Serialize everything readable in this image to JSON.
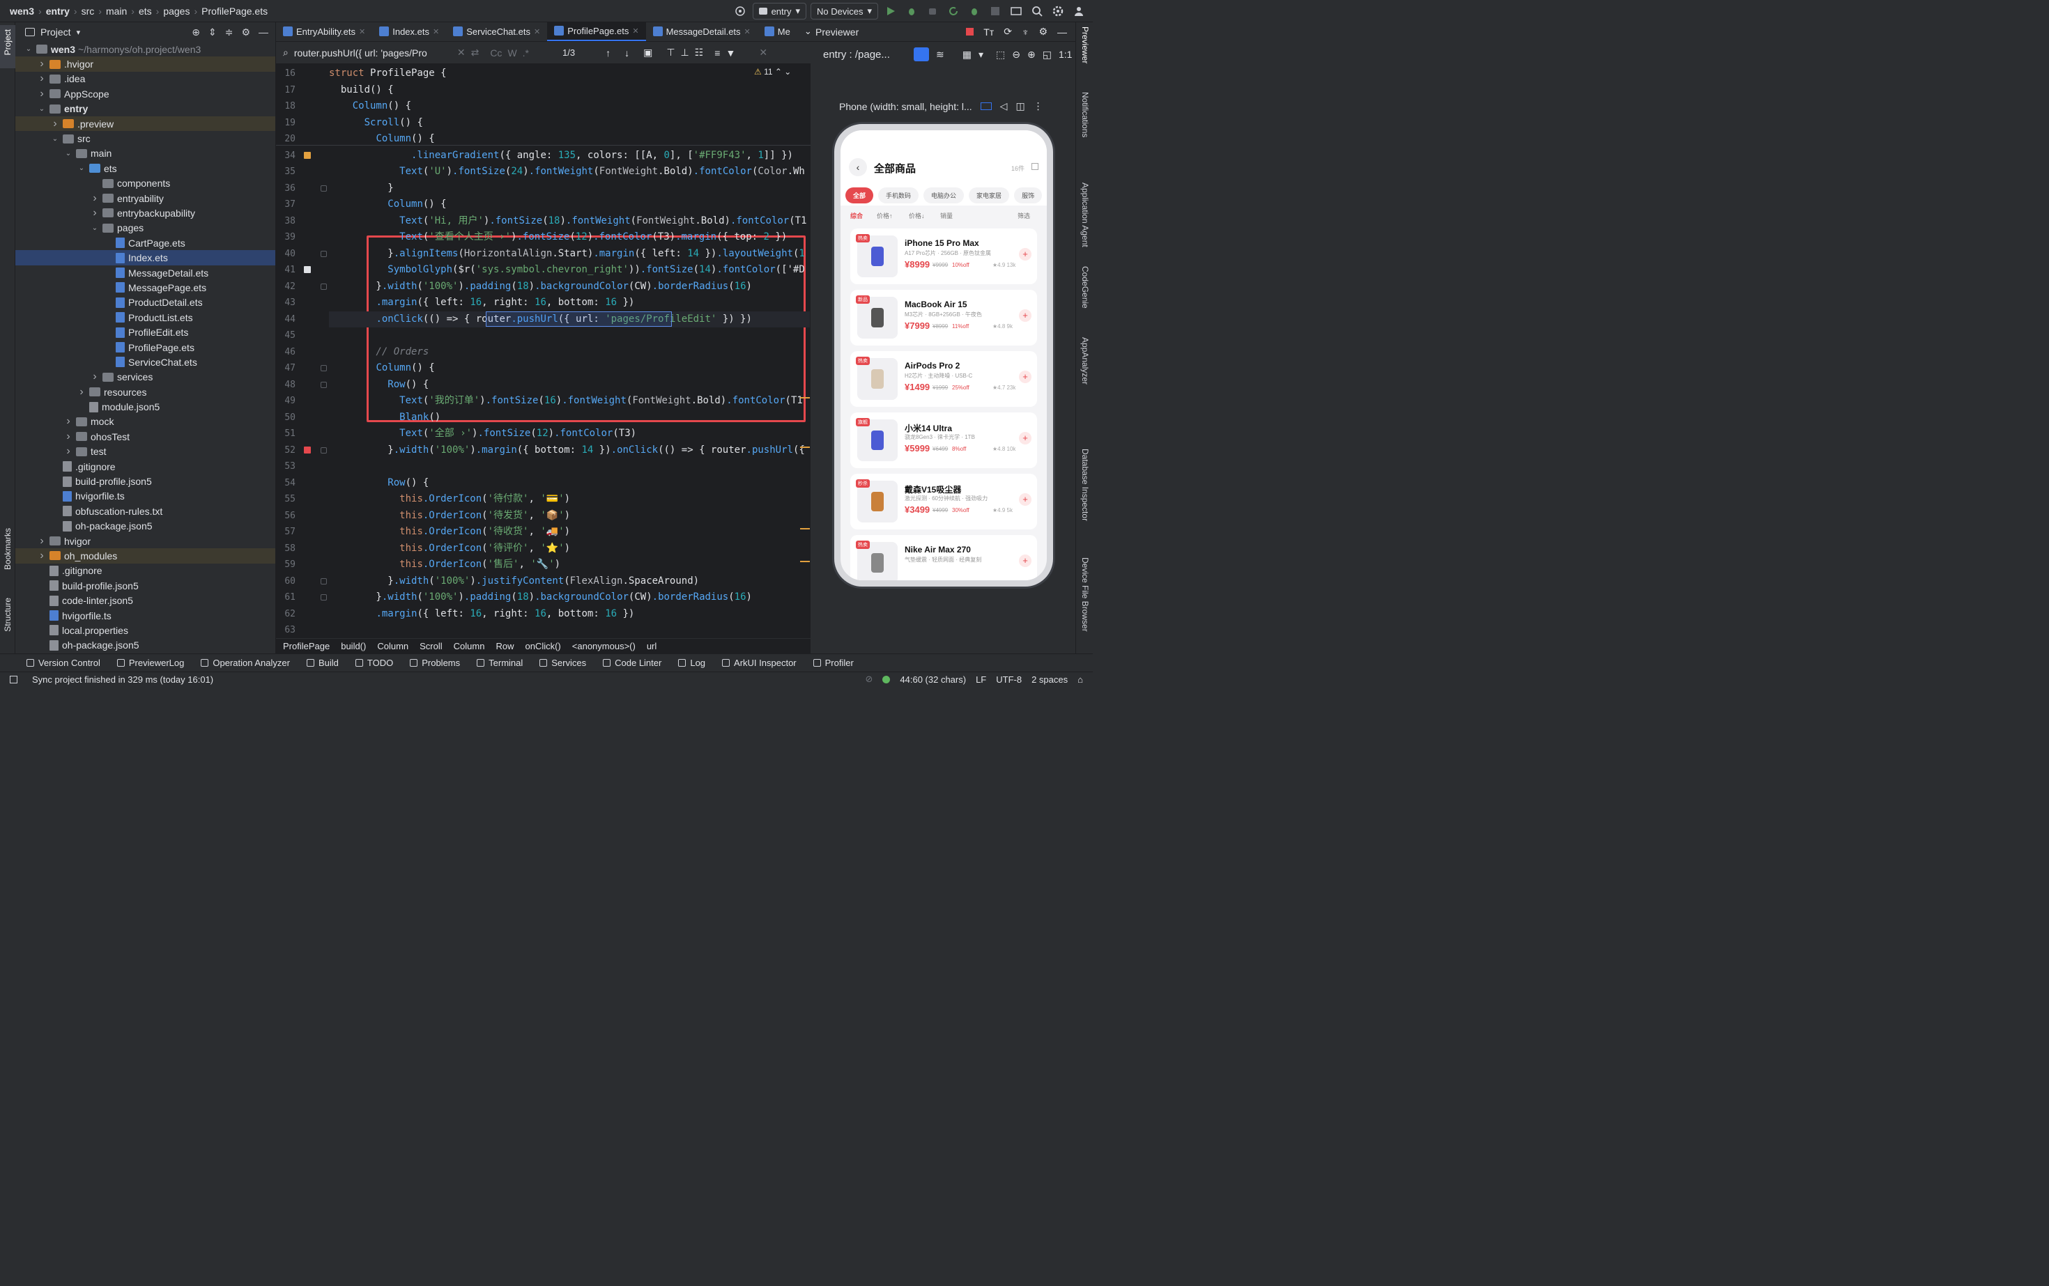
{
  "topbar": {
    "breadcrumb": [
      "wen3",
      "entry",
      "src",
      "main",
      "ets",
      "pages",
      "ProfilePage.ets"
    ],
    "run_config": "entry",
    "device": "No Devices"
  },
  "left_strip": {
    "project": "Project",
    "bookmarks": "Bookmarks",
    "structure": "Structure"
  },
  "project": {
    "title": "Project",
    "tree": [
      {
        "label": "wen3",
        "suffix": "~/harmonys/oh.project/wen3",
        "depth": 0,
        "arrow": "v",
        "icon": "folder"
      },
      {
        "label": ".hvigor",
        "depth": 1,
        "arrow": ">",
        "icon": "ofolder"
      },
      {
        "label": ".idea",
        "depth": 1,
        "arrow": ">",
        "icon": "folder"
      },
      {
        "label": "AppScope",
        "depth": 1,
        "arrow": ">",
        "icon": "folder"
      },
      {
        "label": "entry",
        "depth": 1,
        "arrow": "v",
        "icon": "folder"
      },
      {
        "label": ".preview",
        "depth": 2,
        "arrow": ">",
        "icon": "ofolder"
      },
      {
        "label": "src",
        "depth": 2,
        "arrow": "v",
        "icon": "folder"
      },
      {
        "label": "main",
        "depth": 3,
        "arrow": "v",
        "icon": "folder"
      },
      {
        "label": "ets",
        "depth": 4,
        "arrow": "v",
        "icon": "bfolder"
      },
      {
        "label": "components",
        "depth": 5,
        "arrow": "",
        "icon": "folder"
      },
      {
        "label": "entryability",
        "depth": 5,
        "arrow": ">",
        "icon": "folder"
      },
      {
        "label": "entrybackupability",
        "depth": 5,
        "arrow": ">",
        "icon": "folder"
      },
      {
        "label": "pages",
        "depth": 5,
        "arrow": "v",
        "icon": "folder"
      },
      {
        "label": "CartPage.ets",
        "depth": 6,
        "arrow": "",
        "icon": "fts"
      },
      {
        "label": "Index.ets",
        "depth": 6,
        "arrow": "",
        "icon": "fts"
      },
      {
        "label": "MessageDetail.ets",
        "depth": 6,
        "arrow": "",
        "icon": "fts"
      },
      {
        "label": "MessagePage.ets",
        "depth": 6,
        "arrow": "",
        "icon": "fts"
      },
      {
        "label": "ProductDetail.ets",
        "depth": 6,
        "arrow": "",
        "icon": "fts"
      },
      {
        "label": "ProductList.ets",
        "depth": 6,
        "arrow": "",
        "icon": "fts"
      },
      {
        "label": "ProfileEdit.ets",
        "depth": 6,
        "arrow": "",
        "icon": "fts"
      },
      {
        "label": "ProfilePage.ets",
        "depth": 6,
        "arrow": "",
        "icon": "fts"
      },
      {
        "label": "ServiceChat.ets",
        "depth": 6,
        "arrow": "",
        "icon": "fts"
      },
      {
        "label": "services",
        "depth": 5,
        "arrow": ">",
        "icon": "folder"
      },
      {
        "label": "resources",
        "depth": 4,
        "arrow": ">",
        "icon": "folder"
      },
      {
        "label": "module.json5",
        "depth": 4,
        "arrow": "",
        "icon": "file"
      },
      {
        "label": "mock",
        "depth": 3,
        "arrow": ">",
        "icon": "folder"
      },
      {
        "label": "ohosTest",
        "depth": 3,
        "arrow": ">",
        "icon": "folder"
      },
      {
        "label": "test",
        "depth": 3,
        "arrow": ">",
        "icon": "folder"
      },
      {
        "label": ".gitignore",
        "depth": 2,
        "arrow": "",
        "icon": "file"
      },
      {
        "label": "build-profile.json5",
        "depth": 2,
        "arrow": "",
        "icon": "file"
      },
      {
        "label": "hvigorfile.ts",
        "depth": 2,
        "arrow": "",
        "icon": "fts"
      },
      {
        "label": "obfuscation-rules.txt",
        "depth": 2,
        "arrow": "",
        "icon": "file"
      },
      {
        "label": "oh-package.json5",
        "depth": 2,
        "arrow": "",
        "icon": "file"
      },
      {
        "label": "hvigor",
        "depth": 1,
        "arrow": ">",
        "icon": "folder"
      },
      {
        "label": "oh_modules",
        "depth": 1,
        "arrow": ">",
        "icon": "ofolder"
      },
      {
        "label": ".gitignore",
        "depth": 1,
        "arrow": "",
        "icon": "file"
      },
      {
        "label": "build-profile.json5",
        "depth": 1,
        "arrow": "",
        "icon": "file"
      },
      {
        "label": "code-linter.json5",
        "depth": 1,
        "arrow": "",
        "icon": "file"
      },
      {
        "label": "hvigorfile.ts",
        "depth": 1,
        "arrow": "",
        "icon": "fts"
      },
      {
        "label": "local.properties",
        "depth": 1,
        "arrow": "",
        "icon": "file"
      },
      {
        "label": "oh-package.json5",
        "depth": 1,
        "arrow": "",
        "icon": "file"
      }
    ]
  },
  "editor": {
    "tabs": [
      "EntryAbility.ets",
      "Index.ets",
      "ServiceChat.ets",
      "ProfilePage.ets",
      "MessageDetail.ets",
      "Me"
    ],
    "active_tab": "ProfilePage.ets",
    "find": {
      "query": "router.pushUrl({ url: 'pages/Pro",
      "count": "1/3",
      "cc": "Cc",
      "w": "W",
      "star": ".*"
    },
    "warnings": "11",
    "breadcrumb": [
      "ProfilePage",
      "build()",
      "Column",
      "Scroll",
      "Column",
      "Row",
      "onClick()",
      "<anonymous>()",
      "url"
    ],
    "lines": [
      {
        "n": "16",
        "t": "struct ProfilePage {"
      },
      {
        "n": "17",
        "t": "  build() {"
      },
      {
        "n": "18",
        "t": "    Column() {"
      },
      {
        "n": "19",
        "t": "      Scroll() {"
      },
      {
        "n": "20",
        "t": "        Column() {"
      },
      {
        "n": "34",
        "t": "              .linearGradient({ angle: 135, colors: [[A, 0], ['#FF9F43', 1]] })"
      },
      {
        "n": "35",
        "t": "            Text('U').fontSize(24).fontWeight(FontWeight.Bold).fontColor(Color.Wh"
      },
      {
        "n": "36",
        "t": "          }"
      },
      {
        "n": "37",
        "t": "          Column() {"
      },
      {
        "n": "38",
        "t": "            Text('Hi, 用户').fontSize(18).fontWeight(FontWeight.Bold).fontColor(T1"
      },
      {
        "n": "39",
        "t": "            Text('查看个人主页 ›').fontSize(12).fontColor(T3).margin({ top: 2 })"
      },
      {
        "n": "40",
        "t": "          }.alignItems(HorizontalAlign.Start).margin({ left: 14 }).layoutWeight(1"
      },
      {
        "n": "41",
        "t": "          SymbolGlyph($r('sys.symbol.chevron_right')).fontSize(14).fontColor(['#D"
      },
      {
        "n": "42",
        "t": "        }.width('100%').padding(18).backgroundColor(CW).borderRadius(16)"
      },
      {
        "n": "43",
        "t": "        .margin({ left: 16, right: 16, bottom: 16 })"
      },
      {
        "n": "44",
        "t": "        .onClick(() => { router.pushUrl({ url: 'pages/ProfileEdit' }) })"
      },
      {
        "n": "45",
        "t": ""
      },
      {
        "n": "46",
        "t": "        // Orders"
      },
      {
        "n": "47",
        "t": "        Column() {"
      },
      {
        "n": "48",
        "t": "          Row() {"
      },
      {
        "n": "49",
        "t": "            Text('我的订单').fontSize(16).fontWeight(FontWeight.Bold).fontColor(T1"
      },
      {
        "n": "50",
        "t": "            Blank()"
      },
      {
        "n": "51",
        "t": "            Text('全部 ›').fontSize(12).fontColor(T3)"
      },
      {
        "n": "52",
        "t": "          }.width('100%').margin({ bottom: 14 }).onClick(() => { router.pushUrl({"
      },
      {
        "n": "53",
        "t": ""
      },
      {
        "n": "54",
        "t": "          Row() {"
      },
      {
        "n": "55",
        "t": "            this.OrderIcon('待付款', '💳')"
      },
      {
        "n": "56",
        "t": "            this.OrderIcon('待发货', '📦')"
      },
      {
        "n": "57",
        "t": "            this.OrderIcon('待收货', '🚚')"
      },
      {
        "n": "58",
        "t": "            this.OrderIcon('待评价', '⭐')"
      },
      {
        "n": "59",
        "t": "            this.OrderIcon('售后', '🔧')"
      },
      {
        "n": "60",
        "t": "          }.width('100%').justifyContent(FlexAlign.SpaceAround)"
      },
      {
        "n": "61",
        "t": "        }.width('100%').padding(18).backgroundColor(CW).borderRadius(16)"
      },
      {
        "n": "62",
        "t": "        .margin({ left: 16, right: 16, bottom: 16 })"
      },
      {
        "n": "63",
        "t": ""
      }
    ]
  },
  "previewer": {
    "title": "Previewer",
    "entry": "entry : /page...",
    "device_label": "Phone (width: small, height: l...",
    "app": {
      "title": "全部商品",
      "count": "16件",
      "chips": [
        "全部",
        "手机数码",
        "电脑办公",
        "家电家居",
        "服饰"
      ],
      "sorts": [
        "综合",
        "价格↑",
        "价格↓",
        "销量",
        "筛选"
      ],
      "products": [
        {
          "tag": "热卖",
          "name": "iPhone 15 Pro Max",
          "spec": "A17 Pro芯片 · 256GB · 原色钛金属",
          "price": "¥8999",
          "old": "¥9999",
          "off": "10%off",
          "rating": "4.9 13k"
        },
        {
          "tag": "新品",
          "name": "MacBook Air 15",
          "spec": "M3芯片 · 8GB+256GB · 午夜色",
          "price": "¥7999",
          "old": "¥8999",
          "off": "11%off",
          "rating": "4.8 9k"
        },
        {
          "tag": "热卖",
          "name": "AirPods Pro 2",
          "spec": "H2芯片 · 主动降噪 · USB-C",
          "price": "¥1499",
          "old": "¥1999",
          "off": "25%off",
          "rating": "4.7 23k"
        },
        {
          "tag": "旗舰",
          "name": "小米14 Ultra",
          "spec": "骁龙8Gen3 · 徕卡光学 · 1TB",
          "price": "¥5999",
          "old": "¥6499",
          "off": "8%off",
          "rating": "4.8 10k"
        },
        {
          "tag": "秒杀",
          "name": "戴森V15吸尘器",
          "spec": "激光探测 · 60分钟续航 · 强劲吸力",
          "price": "¥3499",
          "old": "¥4999",
          "off": "30%off",
          "rating": "4.9 5k"
        },
        {
          "tag": "热卖",
          "name": "Nike Air Max 270",
          "spec": "气垫缓震 · 轻质网面 · 经典复刻",
          "price": "",
          "old": "",
          "off": "",
          "rating": ""
        }
      ]
    }
  },
  "right_strip": [
    "Previewer",
    "Notifications",
    "Application Agent",
    "CodeGenie",
    "AppAnalyzer",
    "Database Inspector",
    "Device File Browser"
  ],
  "bottom_tools": [
    "Version Control",
    "PreviewerLog",
    "Operation Analyzer",
    "Build",
    "TODO",
    "Problems",
    "Terminal",
    "Services",
    "Code Linter",
    "Log",
    "ArkUI Inspector",
    "Profiler"
  ],
  "status": {
    "message": "Sync project finished in 329 ms (today 16:01)",
    "position": "44:60 (32 chars)",
    "line_sep": "LF",
    "encoding": "UTF-8",
    "indent": "2 spaces"
  }
}
